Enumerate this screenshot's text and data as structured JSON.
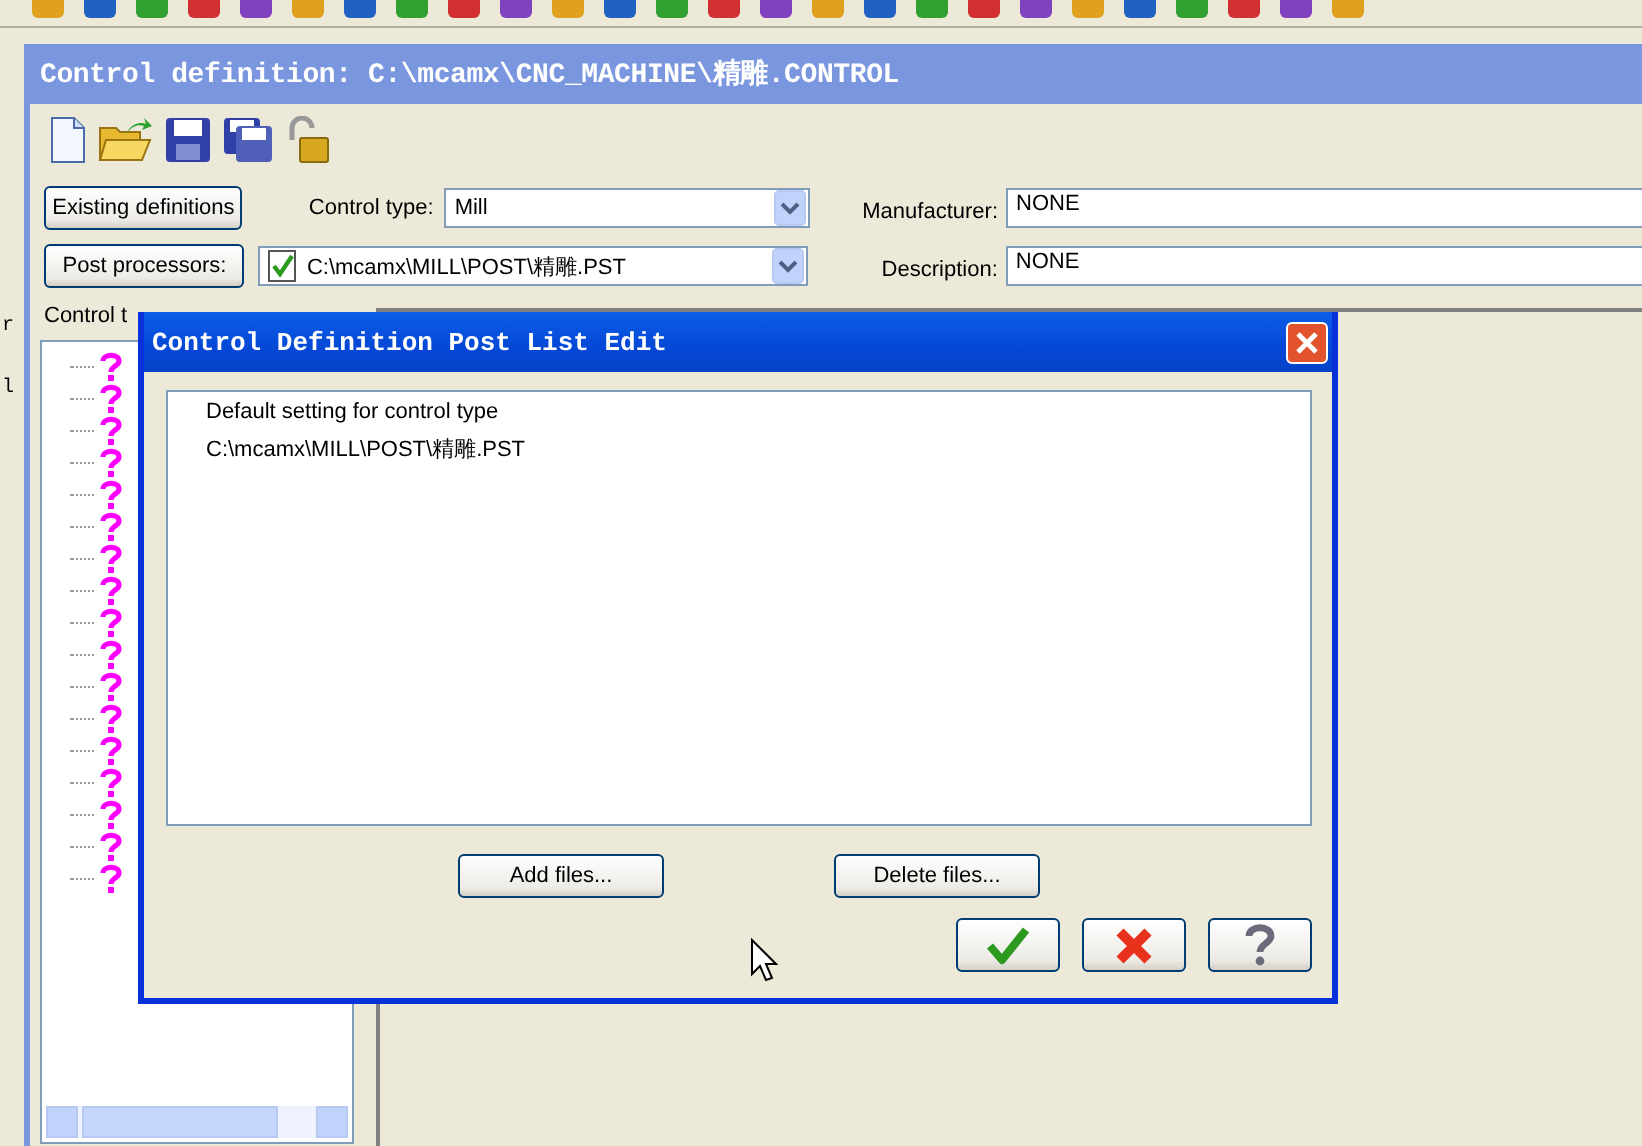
{
  "background_app": {
    "fragments": [
      "r",
      "l"
    ]
  },
  "window": {
    "title": "Control definition: C:\\mcamx\\CNC_MACHINE\\精雕.CONTROL"
  },
  "existing_definitions_button": "Existing definitions",
  "control_type": {
    "label": "Control type:",
    "value": "Mill"
  },
  "post_processors_button": "Post processors:",
  "post_processor": {
    "value": "C:\\mcamx\\MILL\\POST\\精雕.PST"
  },
  "manufacturer": {
    "label": "Manufacturer:",
    "value": "NONE"
  },
  "description": {
    "label": "Description:",
    "value": "NONE"
  },
  "tree": {
    "title": "Control t",
    "items": [
      {
        "kind": "unknown"
      },
      {
        "kind": "unknown"
      },
      {
        "kind": "unknown"
      },
      {
        "kind": "unknown"
      },
      {
        "kind": "unknown"
      },
      {
        "kind": "unknown"
      },
      {
        "kind": "unknown"
      },
      {
        "kind": "unknown"
      },
      {
        "kind": "unknown"
      },
      {
        "kind": "unknown"
      },
      {
        "kind": "unknown"
      },
      {
        "kind": "unknown"
      },
      {
        "kind": "unknown"
      },
      {
        "kind": "unknown"
      },
      {
        "kind": "unknown"
      },
      {
        "kind": "unknown"
      },
      {
        "kind": "unknown"
      }
    ]
  },
  "dialog": {
    "title": "Control Definition Post List Edit",
    "list": [
      "Default setting for control type",
      "C:\\mcamx\\MILL\\POST\\精雕.PST"
    ],
    "buttons": [
      "Add files...",
      "Delete files..."
    ],
    "action_buttons": [
      {
        "kind": "ok"
      },
      {
        "kind": "cancel"
      },
      {
        "kind": "help"
      }
    ]
  }
}
